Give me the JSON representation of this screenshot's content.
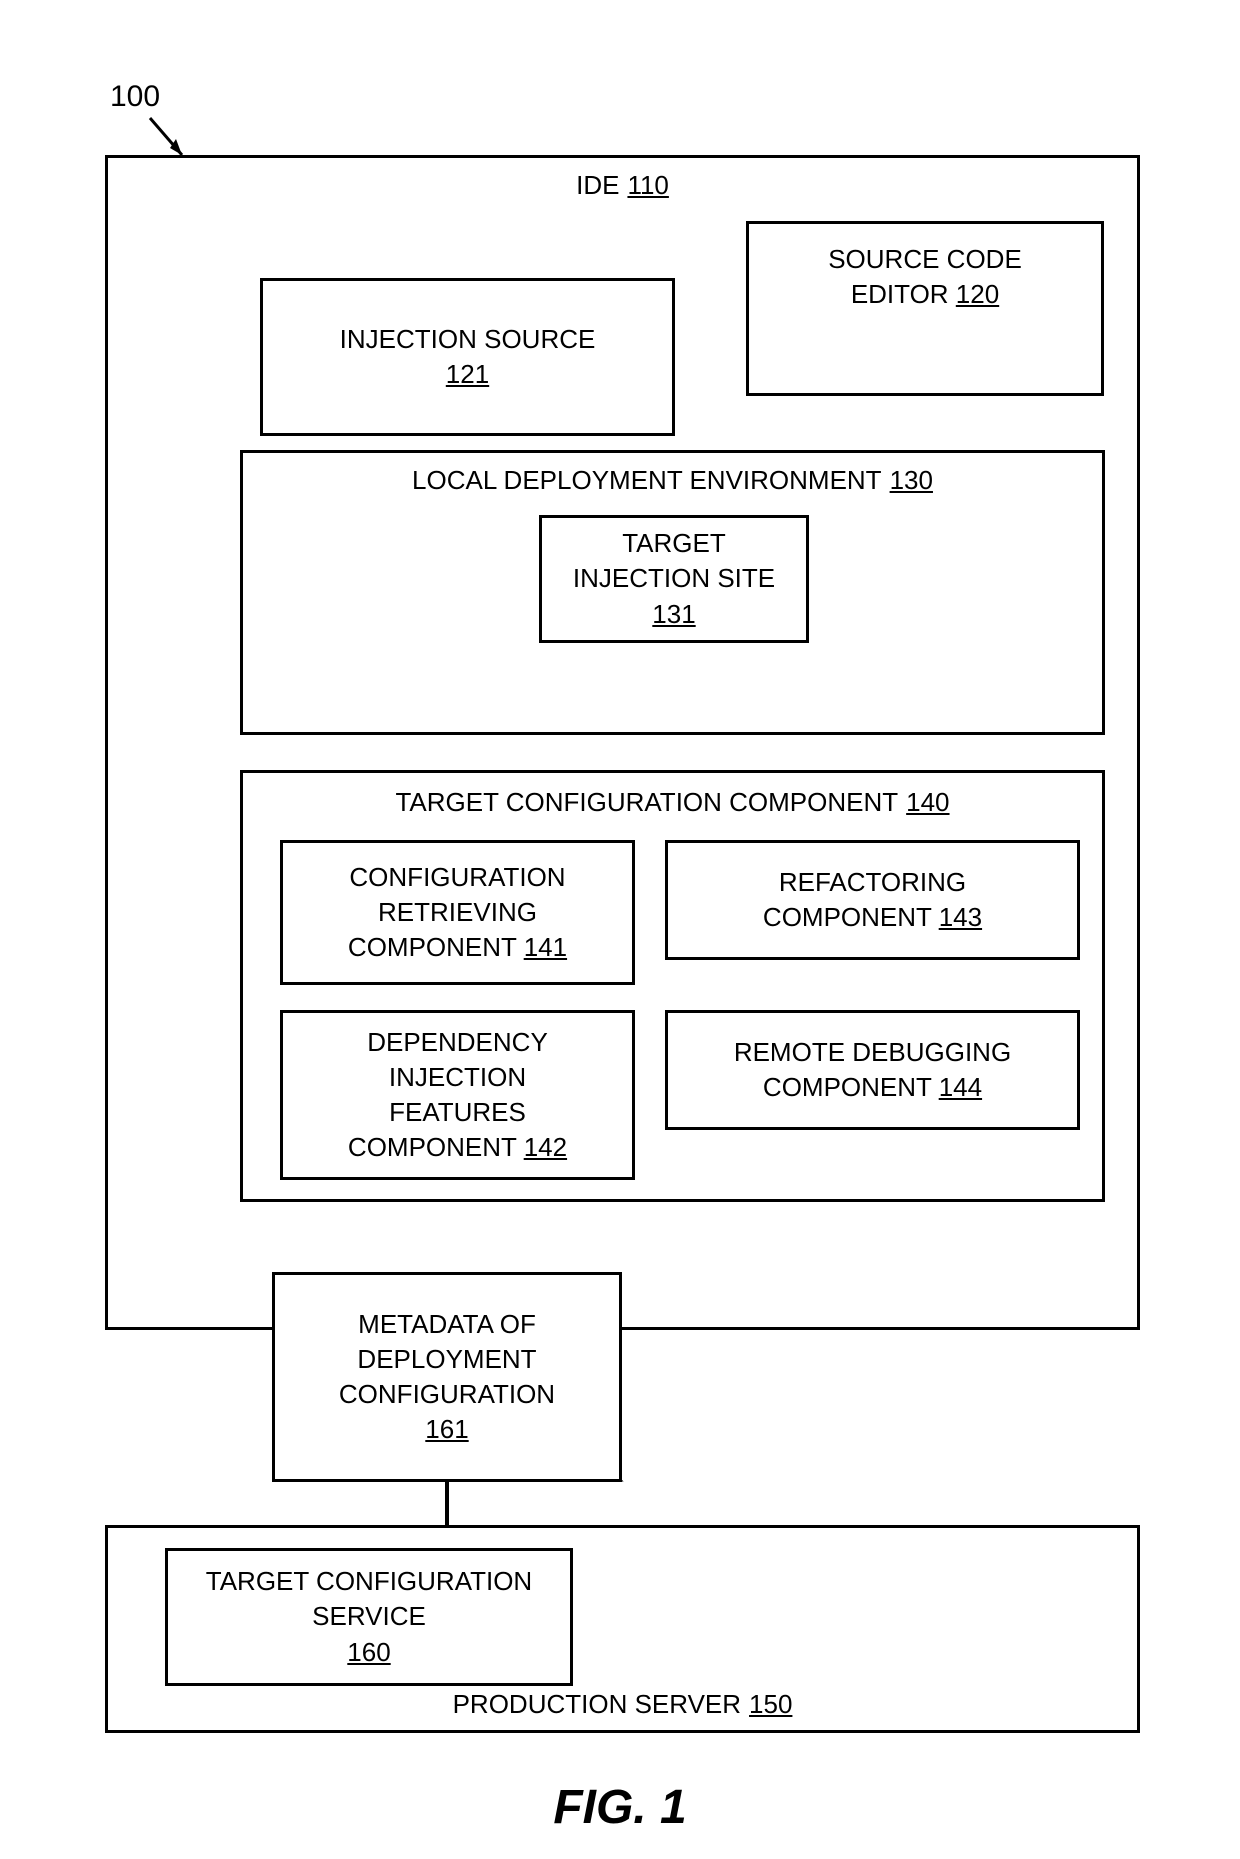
{
  "figure": {
    "number": "100",
    "caption": "FIG. 1"
  },
  "ide": {
    "label": "IDE",
    "ref": "110"
  },
  "source_code_editor": {
    "label": "SOURCE CODE EDITOR",
    "ref": "120"
  },
  "injection_source": {
    "label": "INJECTION SOURCE",
    "ref": "121"
  },
  "local_env": {
    "label": "LOCAL DEPLOYMENT ENVIRONMENT",
    "ref": "130"
  },
  "target_injection_site": {
    "label": "TARGET INJECTION SITE",
    "ref": "131"
  },
  "target_cfg_component": {
    "label": "TARGET CONFIGURATION COMPONENT",
    "ref": "140"
  },
  "cfg_retrieving": {
    "label": "CONFIGURATION RETRIEVING COMPONENT",
    "ref": "141"
  },
  "di_features": {
    "label": "DEPENDENCY INJECTION FEATURES COMPONENT",
    "ref": "142"
  },
  "refactoring": {
    "label": "REFACTORING COMPONENT",
    "ref": "143"
  },
  "remote_debug": {
    "label": "REMOTE DEBUGGING COMPONENT",
    "ref": "144"
  },
  "metadata_note": {
    "line1": "METADATA OF",
    "line2": "DEPLOYMENT",
    "line3": "CONFIGURATION",
    "ref": "161"
  },
  "target_cfg_service": {
    "label": "TARGET CONFIGURATION SERVICE",
    "ref": "160"
  },
  "production_server": {
    "label": "PRODUCTION SERVER",
    "ref": "150"
  }
}
